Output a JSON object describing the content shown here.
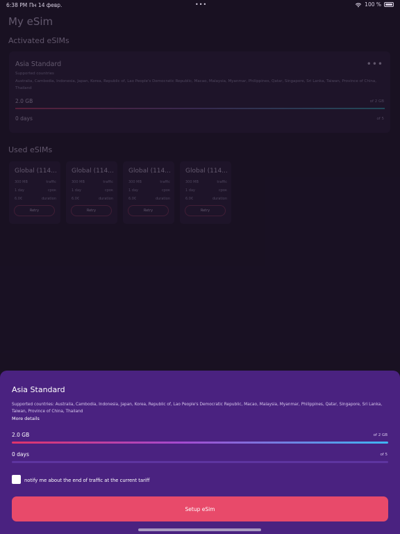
{
  "status_bar": {
    "time": "6:38 PM",
    "date": "Пн 14 февр.",
    "battery": "100 %"
  },
  "page": {
    "title": "My eSim",
    "activated_title": "Activated eSIMs",
    "used_title": "Used eSIMs"
  },
  "active_esim": {
    "name": "Asia Standard",
    "supported_label": "Supported countries",
    "countries": "Australia, Cambodia, Indonesia, Japan, Korea, Republic of, Lao People's Democratic Republic, Macao, Malaysia, Myanmar, Philippines, Qatar, Singapore, Sri Lanka, Taiwan, Province of China, Thailand",
    "traffic_value": "2.0 GB",
    "traffic_total": "of 2 GB",
    "days_value": "0 days",
    "days_total": "of 5"
  },
  "used_esims": [
    {
      "name": "Global (114...",
      "traffic": "300 MB",
      "traffic_label": "traffic",
      "period": "1 day",
      "period_label": "срок",
      "price": "6.0€",
      "price_label": "duration",
      "retry_label": "Retry"
    },
    {
      "name": "Global (114...",
      "traffic": "300 MB",
      "traffic_label": "traffic",
      "period": "1 day",
      "period_label": "срок",
      "price": "6.0€",
      "price_label": "duration",
      "retry_label": "Retry"
    },
    {
      "name": "Global (114...",
      "traffic": "300 MB",
      "traffic_label": "traffic",
      "period": "1 day",
      "period_label": "срок",
      "price": "6.0€",
      "price_label": "duration",
      "retry_label": "Retry"
    },
    {
      "name": "Global (114...",
      "traffic": "300 MB",
      "traffic_label": "traffic",
      "period": "1 day",
      "period_label": "срок",
      "price": "6.0€",
      "price_label": "duration",
      "retry_label": "Retry"
    }
  ],
  "sheet": {
    "title": "Asia Standard",
    "countries": "Supported countries: Australia, Cambodia, Indonesia, Japan, Korea, Republic of, Lao People's Democratic Republic, Macao, Malaysia, Myanmar, Philippines, Qatar, Singapore, Sri Lanka, Taiwan, Province of China, Thailand",
    "more_details": "More details",
    "traffic_value": "2.0 GB",
    "traffic_total": "of 2 GB",
    "traffic_fraction": 1.0,
    "days_value": "0 days",
    "days_total": "of 5",
    "days_fraction": 0.0,
    "notify_label": "notify me about the end of traffic at the current tariff",
    "notify_checked": false,
    "setup_button": "Setup eSim"
  },
  "colors": {
    "background": "#1c1426",
    "sheet": "#4a2280",
    "accent_button": "#e84a6a"
  }
}
